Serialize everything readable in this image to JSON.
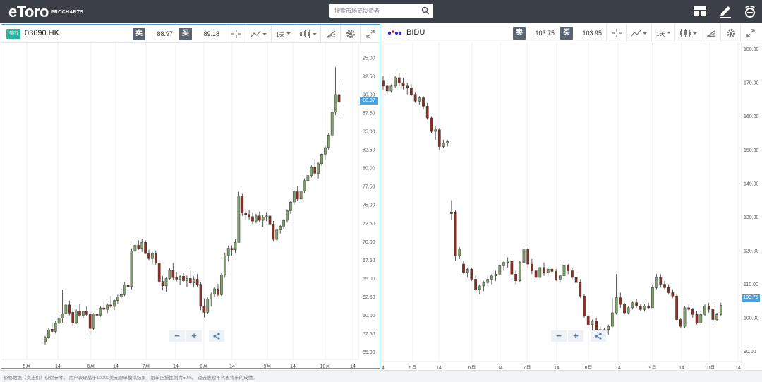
{
  "app": {
    "logo": "eToro",
    "logo_sub": "PROCHARTS"
  },
  "search": {
    "placeholder": "搜索市场或投资者"
  },
  "toolbar_icons": [
    "layout-icon",
    "pencil-icon",
    "etoro-user-icon"
  ],
  "panels": [
    {
      "symbol": "03690.HK",
      "badge": "美团",
      "sell_label": "卖",
      "sell_price": "88.97",
      "buy_label": "买",
      "buy_price": "89.18",
      "timeframe": "1天",
      "current_price": "88.97",
      "y_ticks": [
        "95.00",
        "92.50",
        "90.00",
        "87.50",
        "85.00",
        "82.50",
        "80.00",
        "77.50",
        "75.00",
        "72.50",
        "70.00",
        "67.50",
        "65.00",
        "62.50",
        "60.00",
        "57.50",
        "55.00"
      ],
      "x_ticks": [
        "5月",
        "14",
        "6月",
        "14",
        "7月",
        "14",
        "8月",
        "14",
        "9月",
        "14",
        "10月",
        "14"
      ],
      "zoom": {
        "minus": "−",
        "plus": "+"
      }
    },
    {
      "symbol": "BIDU",
      "sell_label": "卖",
      "sell_price": "103.75",
      "buy_label": "买",
      "buy_price": "103.95",
      "timeframe": "1天",
      "current_price": "103.75",
      "y_ticks": [
        "180.00",
        "170.00",
        "160.00",
        "150.00",
        "140.00",
        "130.00",
        "120.00",
        "110.00",
        "100.00",
        "90.00"
      ],
      "x_ticks": [
        "4",
        "5月",
        "14",
        "6月",
        "14",
        "7月",
        "14",
        "8月",
        "14",
        "9月",
        "14",
        "10月",
        "14"
      ],
      "zoom": {
        "minus": "−",
        "plus": "+"
      }
    }
  ],
  "chart_data": [
    {
      "type": "candlestick",
      "title": "03690.HK",
      "ylim": [
        54,
        97
      ],
      "up_color": "#7fa36b",
      "down_color": "#8b2f22",
      "candles": [
        [
          56.4,
          57.2,
          56.0,
          57.0
        ],
        [
          57.0,
          58.2,
          56.8,
          58.0
        ],
        [
          58.1,
          59.0,
          57.6,
          57.8
        ],
        [
          57.8,
          59.2,
          57.5,
          58.9
        ],
        [
          58.9,
          60.2,
          58.4,
          59.6
        ],
        [
          59.6,
          63.5,
          59.0,
          60.2
        ],
        [
          60.2,
          61.8,
          59.8,
          61.4
        ],
        [
          61.4,
          62.0,
          60.0,
          60.3
        ],
        [
          60.4,
          61.0,
          58.6,
          59.0
        ],
        [
          59.0,
          60.8,
          58.8,
          60.6
        ],
        [
          60.6,
          61.5,
          59.8,
          60.0
        ],
        [
          60.0,
          60.6,
          59.6,
          60.5
        ],
        [
          60.5,
          61.2,
          59.9,
          60.1
        ],
        [
          60.1,
          60.5,
          57.4,
          58.2
        ],
        [
          58.2,
          60.3,
          58.0,
          60.2
        ],
        [
          60.2,
          61.0,
          59.7,
          60.0
        ],
        [
          60.0,
          61.2,
          59.8,
          61.0
        ],
        [
          61.0,
          62.0,
          60.7,
          60.8
        ],
        [
          60.8,
          61.6,
          60.3,
          61.4
        ],
        [
          61.4,
          62.6,
          61.0,
          61.2
        ],
        [
          61.2,
          62.2,
          60.7,
          62.0
        ],
        [
          62.0,
          62.8,
          61.5,
          62.5
        ],
        [
          62.5,
          63.6,
          62.2,
          62.8
        ],
        [
          62.8,
          64.5,
          62.6,
          64.1
        ],
        [
          64.1,
          64.8,
          63.6,
          63.9
        ],
        [
          63.9,
          69.1,
          63.5,
          68.7
        ],
        [
          68.7,
          70.0,
          68.3,
          69.5
        ],
        [
          69.5,
          70.2,
          68.9,
          69.1
        ],
        [
          69.1,
          70.4,
          68.6,
          69.9
        ],
        [
          69.9,
          70.2,
          68.3,
          68.4
        ],
        [
          68.4,
          68.9,
          67.5,
          67.7
        ],
        [
          67.7,
          68.6,
          66.9,
          68.4
        ],
        [
          68.4,
          68.8,
          66.9,
          67.1
        ],
        [
          67.1,
          67.4,
          64.3,
          64.6
        ],
        [
          64.6,
          65.3,
          63.4,
          64.0
        ],
        [
          64.0,
          65.2,
          63.2,
          65.0
        ],
        [
          65.0,
          66.4,
          64.8,
          66.1
        ],
        [
          66.1,
          67.1,
          64.8,
          65.1
        ],
        [
          65.1,
          65.9,
          64.6,
          64.9
        ],
        [
          64.9,
          65.5,
          64.1,
          65.3
        ],
        [
          65.3,
          65.8,
          64.5,
          64.7
        ],
        [
          64.7,
          65.4,
          63.8,
          65.0
        ],
        [
          65.0,
          66.1,
          64.2,
          64.4
        ],
        [
          64.4,
          65.3,
          63.9,
          64.9
        ],
        [
          64.9,
          65.6,
          63.9,
          64.2
        ],
        [
          64.2,
          64.5,
          60.7,
          61.2
        ],
        [
          61.2,
          62.3,
          59.7,
          60.4
        ],
        [
          60.4,
          62.4,
          60.2,
          62.2
        ],
        [
          62.2,
          63.1,
          61.2,
          62.9
        ],
        [
          62.9,
          63.8,
          62.5,
          63.6
        ],
        [
          63.6,
          64.3,
          62.6,
          62.8
        ],
        [
          62.8,
          65.7,
          62.6,
          65.5
        ],
        [
          65.5,
          68.5,
          65.1,
          68.1
        ],
        [
          68.1,
          69.5,
          67.3,
          69.1
        ],
        [
          69.1,
          69.5,
          68.1,
          68.9
        ],
        [
          68.9,
          70.3,
          68.5,
          69.9
        ],
        [
          69.9,
          76.8,
          71.8,
          76.2
        ],
        [
          76.2,
          76.5,
          73.5,
          73.9
        ],
        [
          73.9,
          74.4,
          72.9,
          73.7
        ],
        [
          73.7,
          74.3,
          73.0,
          73.4
        ],
        [
          73.4,
          74.0,
          72.4,
          72.8
        ],
        [
          72.8,
          73.8,
          72.5,
          73.5
        ],
        [
          73.5,
          74.1,
          72.6,
          72.9
        ],
        [
          72.9,
          73.6,
          72.0,
          73.3
        ],
        [
          73.3,
          74.0,
          72.8,
          73.5
        ],
        [
          73.5,
          74.2,
          72.8,
          72.4
        ],
        [
          72.4,
          72.8,
          70.0,
          70.3
        ],
        [
          70.3,
          71.9,
          70.1,
          71.6
        ],
        [
          71.6,
          72.3,
          71.1,
          72.1
        ],
        [
          72.1,
          73.1,
          71.7,
          72.9
        ],
        [
          72.9,
          74.4,
          72.6,
          74.2
        ],
        [
          74.2,
          75.6,
          73.8,
          75.4
        ],
        [
          75.4,
          77.0,
          75.0,
          76.8
        ],
        [
          76.8,
          77.5,
          75.5,
          75.8
        ],
        [
          75.8,
          77.1,
          75.5,
          76.9
        ],
        [
          76.9,
          78.6,
          76.6,
          78.3
        ],
        [
          78.3,
          79.1,
          77.3,
          79.0
        ],
        [
          79.0,
          80.4,
          78.7,
          80.1
        ],
        [
          80.1,
          81.2,
          79.0,
          79.3
        ],
        [
          79.3,
          80.8,
          78.6,
          80.6
        ],
        [
          80.6,
          82.1,
          80.3,
          81.9
        ],
        [
          81.9,
          83.1,
          81.1,
          82.8
        ],
        [
          82.8,
          84.8,
          82.5,
          84.5
        ],
        [
          84.5,
          88.0,
          84.1,
          87.6
        ],
        [
          87.6,
          93.7,
          87.2,
          90.0
        ],
        [
          90.0,
          91.5,
          86.8,
          89.0
        ]
      ]
    },
    {
      "type": "candlestick",
      "title": "BIDU",
      "ylim": [
        87,
        182
      ],
      "up_color": "#7fa36b",
      "down_color": "#8b2f22",
      "candles": [
        [
          170.5,
          172.0,
          168.0,
          169.0
        ],
        [
          169.0,
          170.0,
          166.5,
          167.5
        ],
        [
          167.5,
          169.5,
          167.0,
          169.0
        ],
        [
          169.0,
          172.0,
          168.5,
          171.5
        ],
        [
          171.5,
          173.0,
          169.0,
          170.0
        ],
        [
          170.0,
          171.5,
          168.0,
          169.0
        ],
        [
          169.0,
          170.0,
          166.5,
          168.5
        ],
        [
          168.5,
          169.5,
          166.0,
          166.5
        ],
        [
          166.5,
          167.0,
          164.0,
          164.5
        ],
        [
          164.5,
          166.0,
          163.5,
          165.5
        ],
        [
          165.5,
          166.0,
          162.0,
          163.0
        ],
        [
          163.0,
          164.0,
          159.0,
          159.5
        ],
        [
          159.5,
          160.0,
          155.0,
          155.5
        ],
        [
          155.5,
          157.0,
          153.0,
          156.0
        ],
        [
          156.0,
          156.5,
          150.0,
          151.0
        ],
        [
          151.0,
          153.0,
          150.5,
          152.0
        ],
        [
          152.0,
          153.0,
          151.0,
          152.5
        ],
        [
          131.0,
          135.0,
          129.0,
          131.5
        ],
        [
          131.5,
          132.0,
          117.0,
          118.5
        ],
        [
          118.5,
          121.0,
          117.5,
          120.5
        ],
        [
          116.0,
          117.0,
          113.0,
          113.5
        ],
        [
          113.5,
          115.0,
          112.0,
          114.5
        ],
        [
          114.5,
          115.0,
          111.0,
          111.5
        ],
        [
          111.5,
          112.5,
          108.0,
          108.5
        ],
        [
          108.5,
          110.0,
          107.0,
          109.5
        ],
        [
          109.5,
          111.0,
          108.0,
          110.5
        ],
        [
          110.5,
          112.0,
          109.5,
          111.5
        ],
        [
          111.5,
          113.0,
          110.0,
          112.5
        ],
        [
          112.5,
          114.0,
          111.0,
          113.0
        ],
        [
          113.0,
          116.0,
          112.5,
          115.5
        ],
        [
          115.5,
          117.0,
          114.0,
          116.5
        ],
        [
          116.5,
          118.0,
          115.0,
          117.0
        ],
        [
          117.0,
          118.5,
          112.0,
          113.0
        ],
        [
          113.0,
          114.0,
          110.0,
          111.0
        ],
        [
          111.0,
          117.0,
          110.5,
          116.5
        ],
        [
          116.5,
          121.0,
          115.5,
          120.5
        ],
        [
          120.5,
          121.0,
          115.0,
          116.0
        ],
        [
          116.0,
          117.5,
          113.0,
          114.0
        ],
        [
          114.0,
          115.0,
          111.0,
          112.0
        ],
        [
          112.0,
          115.5,
          111.5,
          115.0
        ],
        [
          115.0,
          116.5,
          112.5,
          113.5
        ],
        [
          113.5,
          115.0,
          112.0,
          114.5
        ],
        [
          114.5,
          115.5,
          113.0,
          113.8
        ],
        [
          113.8,
          114.5,
          111.0,
          111.5
        ],
        [
          111.5,
          113.0,
          110.5,
          112.5
        ],
        [
          112.5,
          116.0,
          112.0,
          115.5
        ],
        [
          115.5,
          116.0,
          113.0,
          114.0
        ],
        [
          114.0,
          115.0,
          111.5,
          112.0
        ],
        [
          112.0,
          113.0,
          110.0,
          110.5
        ],
        [
          110.5,
          111.5,
          106.0,
          106.5
        ],
        [
          106.5,
          107.0,
          100.0,
          100.5
        ],
        [
          100.5,
          101.0,
          97.5,
          98.0
        ],
        [
          98.0,
          99.5,
          96.0,
          99.0
        ],
        [
          99.0,
          100.0,
          95.5,
          96.5
        ],
        [
          96.5,
          97.5,
          94.5,
          95.0
        ],
        [
          95.0,
          97.0,
          94.5,
          96.5
        ],
        [
          96.5,
          98.0,
          95.0,
          97.5
        ],
        [
          97.5,
          106.0,
          97.0,
          101.5
        ],
        [
          101.5,
          113.0,
          101.0,
          106.0
        ],
        [
          106.0,
          107.5,
          103.0,
          104.0
        ],
        [
          104.0,
          104.5,
          101.0,
          101.5
        ],
        [
          101.5,
          103.5,
          101.0,
          103.0
        ],
        [
          103.0,
          105.0,
          102.5,
          104.5
        ],
        [
          104.5,
          105.5,
          103.0,
          103.5
        ],
        [
          103.5,
          104.0,
          102.0,
          102.5
        ],
        [
          102.5,
          104.0,
          102.0,
          103.5
        ],
        [
          103.5,
          104.5,
          102.5,
          103.0
        ],
        [
          103.0,
          110.0,
          103.0,
          109.0
        ],
        [
          109.0,
          113.0,
          108.5,
          112.0
        ],
        [
          112.0,
          113.0,
          109.0,
          110.0
        ],
        [
          110.0,
          111.0,
          108.5,
          109.0
        ],
        [
          109.0,
          110.0,
          107.0,
          107.5
        ],
        [
          107.5,
          108.5,
          106.0,
          106.5
        ],
        [
          106.5,
          107.0,
          99.0,
          99.5
        ],
        [
          99.5,
          100.0,
          97.0,
          97.5
        ],
        [
          97.5,
          103.5,
          97.0,
          103.0
        ],
        [
          103.0,
          104.0,
          102.0,
          102.5
        ],
        [
          102.5,
          103.0,
          100.0,
          101.0
        ],
        [
          101.0,
          102.0,
          98.0,
          98.5
        ],
        [
          98.5,
          101.5,
          98.0,
          101.0
        ],
        [
          101.0,
          104.0,
          100.5,
          103.5
        ],
        [
          103.5,
          104.5,
          101.5,
          102.5
        ],
        [
          102.5,
          104.0,
          98.5,
          99.5
        ],
        [
          99.5,
          101.5,
          99.0,
          101.0
        ],
        [
          101.0,
          104.5,
          100.5,
          103.75
        ]
      ]
    }
  ]
}
